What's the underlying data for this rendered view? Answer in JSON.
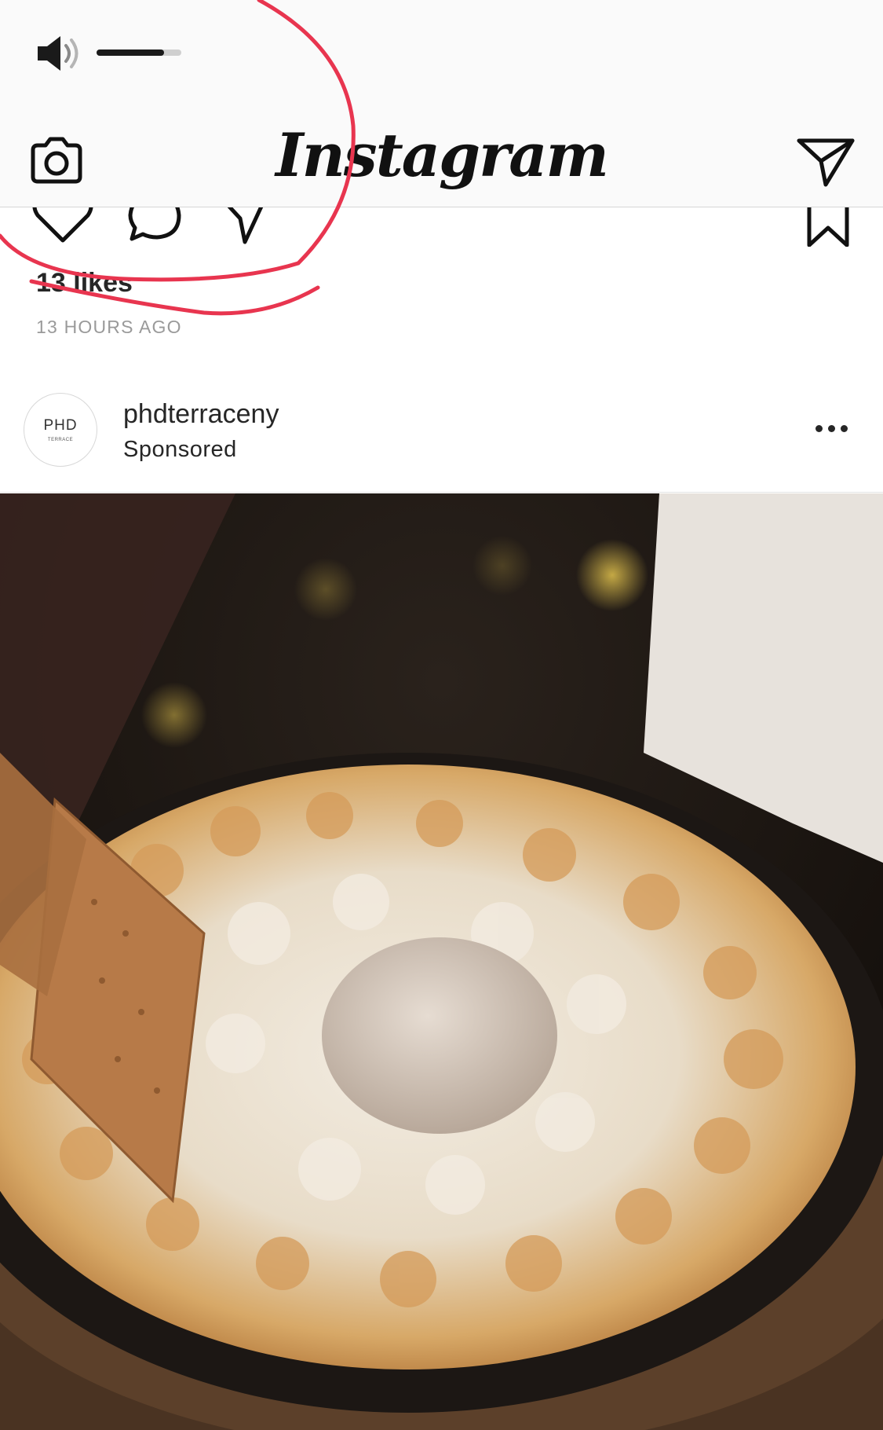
{
  "status": {
    "volume_icon": "speaker-icon",
    "volume_level": 0.8
  },
  "header": {
    "title": "Instagram",
    "left_icon": "camera-icon",
    "right_icon": "paper-plane-icon"
  },
  "previous_post": {
    "actions": [
      "heart-icon",
      "comment-icon",
      "share-icon",
      "bookmark-icon"
    ],
    "likes": "13 likes",
    "time_ago": "13 HOURS AGO"
  },
  "post": {
    "avatar_text": "PHD",
    "avatar_subtext": "TERRACE",
    "username": "phdterraceny",
    "label": "Sponsored",
    "more_icon": "more-horizontal-icon",
    "media_description_icon": "food-photo"
  },
  "colors": {
    "annotation": "#e8354f",
    "text": "#262626",
    "muted": "#9a9a9a"
  }
}
